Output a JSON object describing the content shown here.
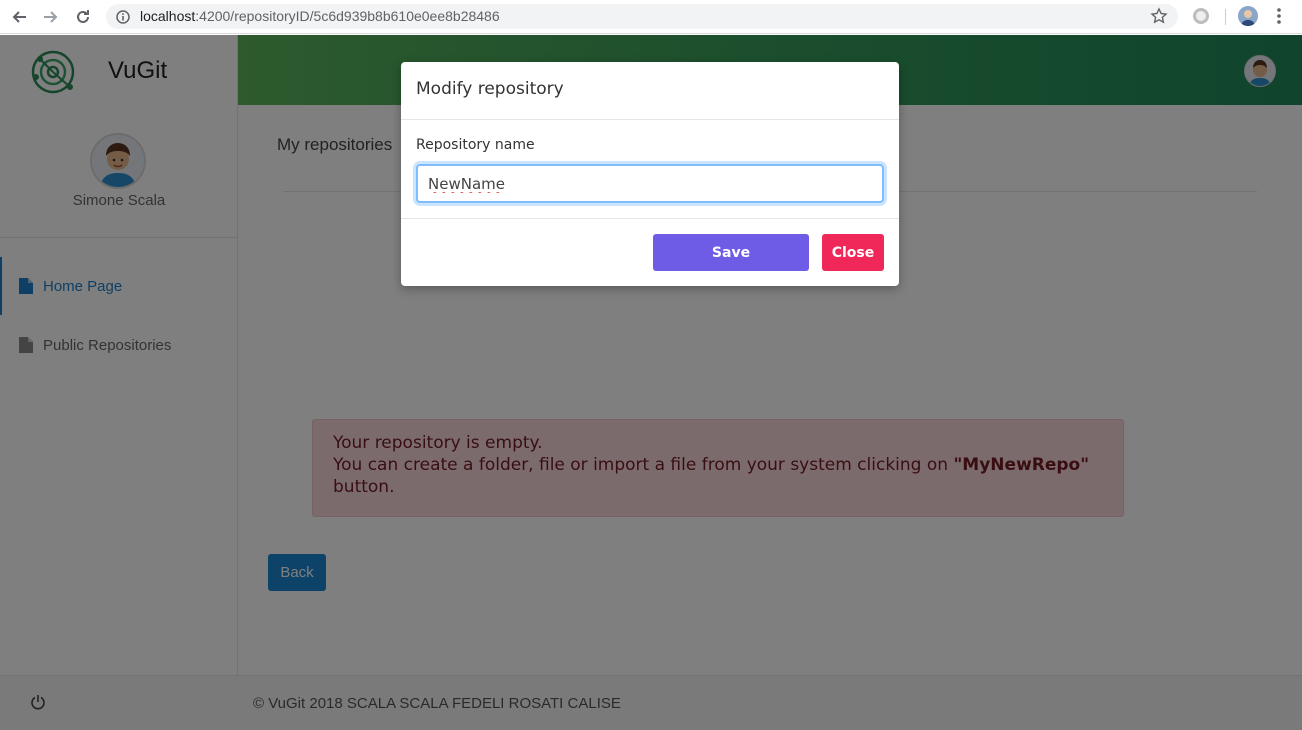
{
  "browser": {
    "url_host": "localhost",
    "url_rest": ":4200/repositoryID/5c6d939b8b610e0ee8b28486",
    "icons": [
      "back-arrow-icon",
      "forward-arrow-icon",
      "reload-icon",
      "info-icon",
      "star-icon",
      "extension-icon",
      "profile-icon",
      "menu-kebab-icon"
    ]
  },
  "app": {
    "brand_name": "VuGit",
    "user_name": "Simone Scala",
    "theme": {
      "topbar_start": "#5cb55b",
      "topbar_end": "#20885a",
      "active": "#1f7fc8"
    }
  },
  "sidebar": {
    "items": [
      {
        "label": "Home Page",
        "icon": "document-icon",
        "active": true
      },
      {
        "label": "Public Repositories",
        "icon": "document-icon",
        "active": false
      }
    ],
    "footer_icon": "power-icon"
  },
  "main": {
    "title": "My repositories",
    "alert": {
      "line1": "Your repository is empty.",
      "line2_pre": "You can create a folder, file or import a file from your system clicking on ",
      "line2_bold": "\"MyNewRepo\"",
      "line3": "button."
    },
    "back_label": "Back"
  },
  "footer": {
    "copyright": "© VuGit 2018 SCALA SCALA FEDELI ROSATI CALISE"
  },
  "modal": {
    "title": "Modify repository",
    "field_label": "Repository name",
    "field_value": "NewName",
    "save_label": "Save",
    "close_label": "Close",
    "colors": {
      "save": "#6f5ce6",
      "close": "#f0285a"
    }
  }
}
